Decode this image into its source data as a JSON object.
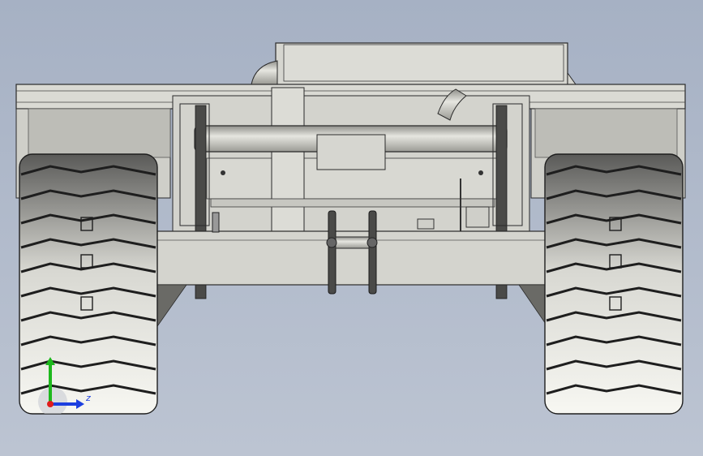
{
  "viewport": {
    "background_top": "#a6b1c4",
    "background_bottom": "#bcc4d2"
  },
  "model": {
    "body_color": "#d9d9d4",
    "edge_color": "#2a2a2a",
    "tire_light": "#f2f2ec",
    "tire_dark": "#3a3a3a"
  },
  "triad": {
    "x_color": "#e01c1c",
    "y_color": "#1db81d",
    "z_color": "#1c3fe0",
    "label": "z"
  }
}
